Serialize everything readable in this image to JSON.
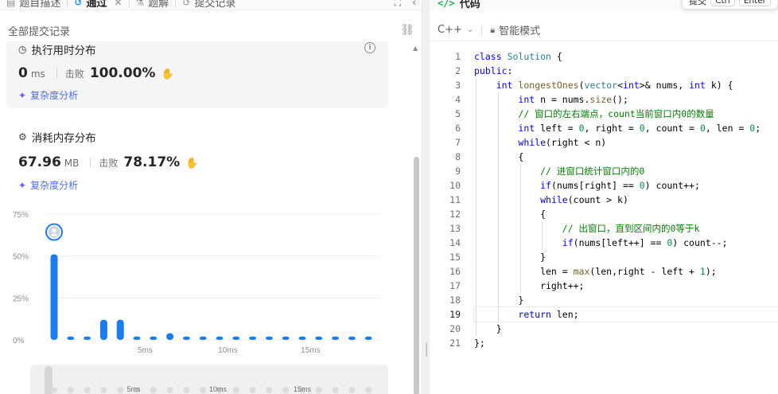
{
  "tabs": [
    {
      "label": "题目描述",
      "icon": "description-icon",
      "active": false
    },
    {
      "label": "通过",
      "icon": "history-icon",
      "active": true
    },
    {
      "label": "题解",
      "icon": "flask-icon",
      "active": false
    },
    {
      "label": "提交记录",
      "icon": "history-icon",
      "active": false
    }
  ],
  "subheader": {
    "title": "全部提交记录"
  },
  "runtime": {
    "title": "执行用时分布",
    "value": "0",
    "unit": "ms",
    "beats_label": "击败",
    "beats_value": "100.00%",
    "analysis_label": "复杂度分析"
  },
  "memory": {
    "title": "消耗内存分布",
    "value": "67.96",
    "unit": "MB",
    "beats_label": "击败",
    "beats_value": "78.17%",
    "analysis_label": "复杂度分析"
  },
  "chart_data": {
    "type": "bar",
    "x": [
      1,
      2,
      3,
      4,
      5,
      6,
      7,
      8,
      9,
      10,
      11,
      12,
      13,
      14,
      15,
      16,
      17,
      18,
      19,
      20
    ],
    "values": [
      51,
      2,
      2,
      12,
      12,
      2,
      2,
      4,
      2,
      2,
      2,
      2,
      2,
      2,
      2,
      2,
      2,
      2,
      2,
      2
    ],
    "yticks": [
      "75%",
      "50%",
      "25%",
      "0%"
    ],
    "xticks": [
      {
        "label": "5ms",
        "at": 5
      },
      {
        "label": "10ms",
        "at": 10
      },
      {
        "label": "15ms",
        "at": 15
      }
    ],
    "ylim": [
      0,
      75
    ],
    "highlight_index": 0,
    "bar_color": "#1a7cf0",
    "grid": true
  },
  "minimap": {
    "xticks": [
      "5ms",
      "10ms",
      "15ms"
    ]
  },
  "code_panel": {
    "title": "代码",
    "shortcut": {
      "label": "提交",
      "key1": "Ctrl",
      "key2": "Enter"
    },
    "language": "C++",
    "mode": "智能模式"
  },
  "code_lines": [
    "class Solution {",
    "public:",
    "    int longestOnes(vector<int>& nums, int k) {",
    "        int n = nums.size();",
    "        // 窗口的左右端点，count当前窗口内0的数量",
    "        int left = 0, right = 0, count = 0, len = 0;",
    "        while(right < n)",
    "        {",
    "            // 进窗口统计窗口内的0",
    "            if(nums[right] == 0) count++;",
    "            while(count > k)",
    "            {",
    "                // 出窗口，直到区间内的0等于k",
    "                if(nums[left++] == 0) count--;",
    "            }",
    "            len = max(len,right - left + 1);",
    "            right++;",
    "        }",
    "        return len;",
    "    }",
    "};"
  ],
  "active_line": 19
}
